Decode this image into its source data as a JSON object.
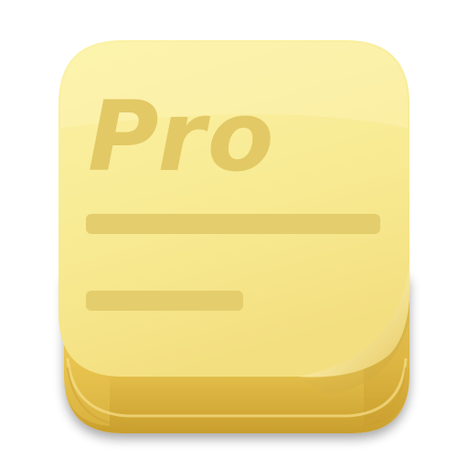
{
  "app_icon": {
    "label": "Pro",
    "icon_name": "sticky-note-pro-icon",
    "colors": {
      "note_light": "#FBF0A0",
      "note_mid": "#F6E68A",
      "base_light": "#F2D570",
      "base_dark": "#D9B23A",
      "base_edge": "#E8C552",
      "text_lines": "#E3CE6A",
      "curl_light": "#FFF6C8",
      "curl_shadow": "#D7B950"
    }
  }
}
